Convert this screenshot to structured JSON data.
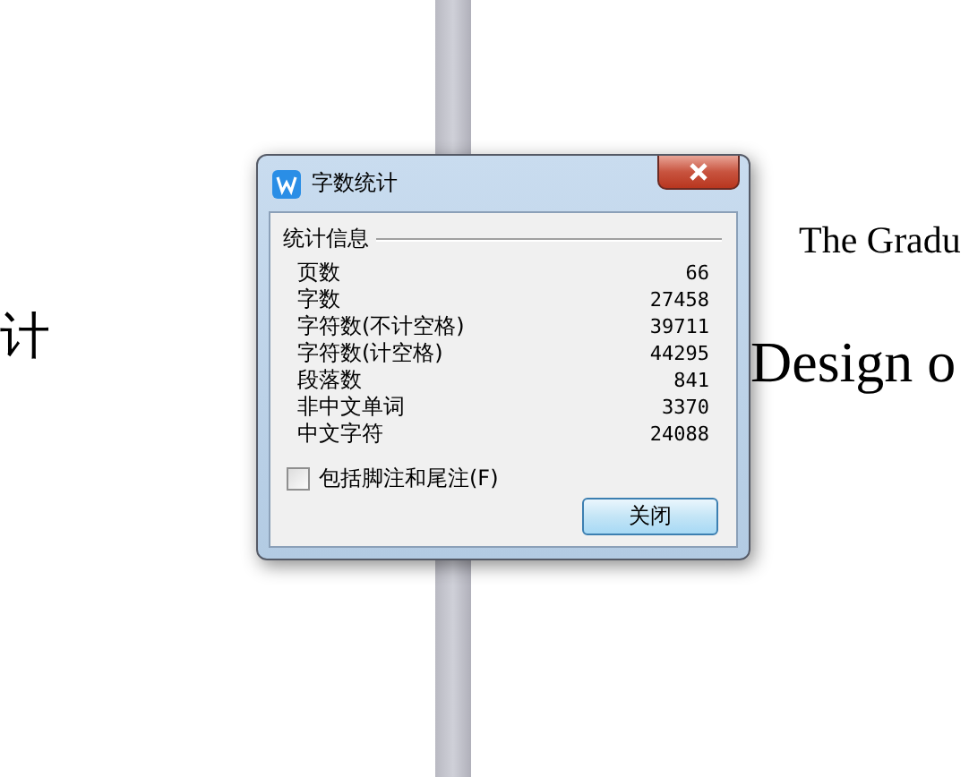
{
  "document": {
    "texts": [
      {
        "text": "计",
        "kind": "cjk"
      },
      {
        "text": "The Gradu",
        "kind": "small"
      },
      {
        "text": "Design o",
        "kind": "large"
      }
    ]
  },
  "window": {
    "title": "字数统计"
  },
  "group": {
    "label": "统计信息"
  },
  "stats": [
    {
      "label": "页数",
      "value": "66"
    },
    {
      "label": "字数",
      "value": "27458"
    },
    {
      "label": "字符数(不计空格)",
      "value": "39711"
    },
    {
      "label": "字符数(计空格)",
      "value": "44295"
    },
    {
      "label": "段落数",
      "value": "841"
    },
    {
      "label": "非中文单词",
      "value": "3370"
    },
    {
      "label": "中文字符",
      "value": "24088"
    }
  ],
  "checkbox": {
    "label": "包括脚注和尾注(F)",
    "checked": false
  },
  "buttons": [
    "关闭"
  ]
}
